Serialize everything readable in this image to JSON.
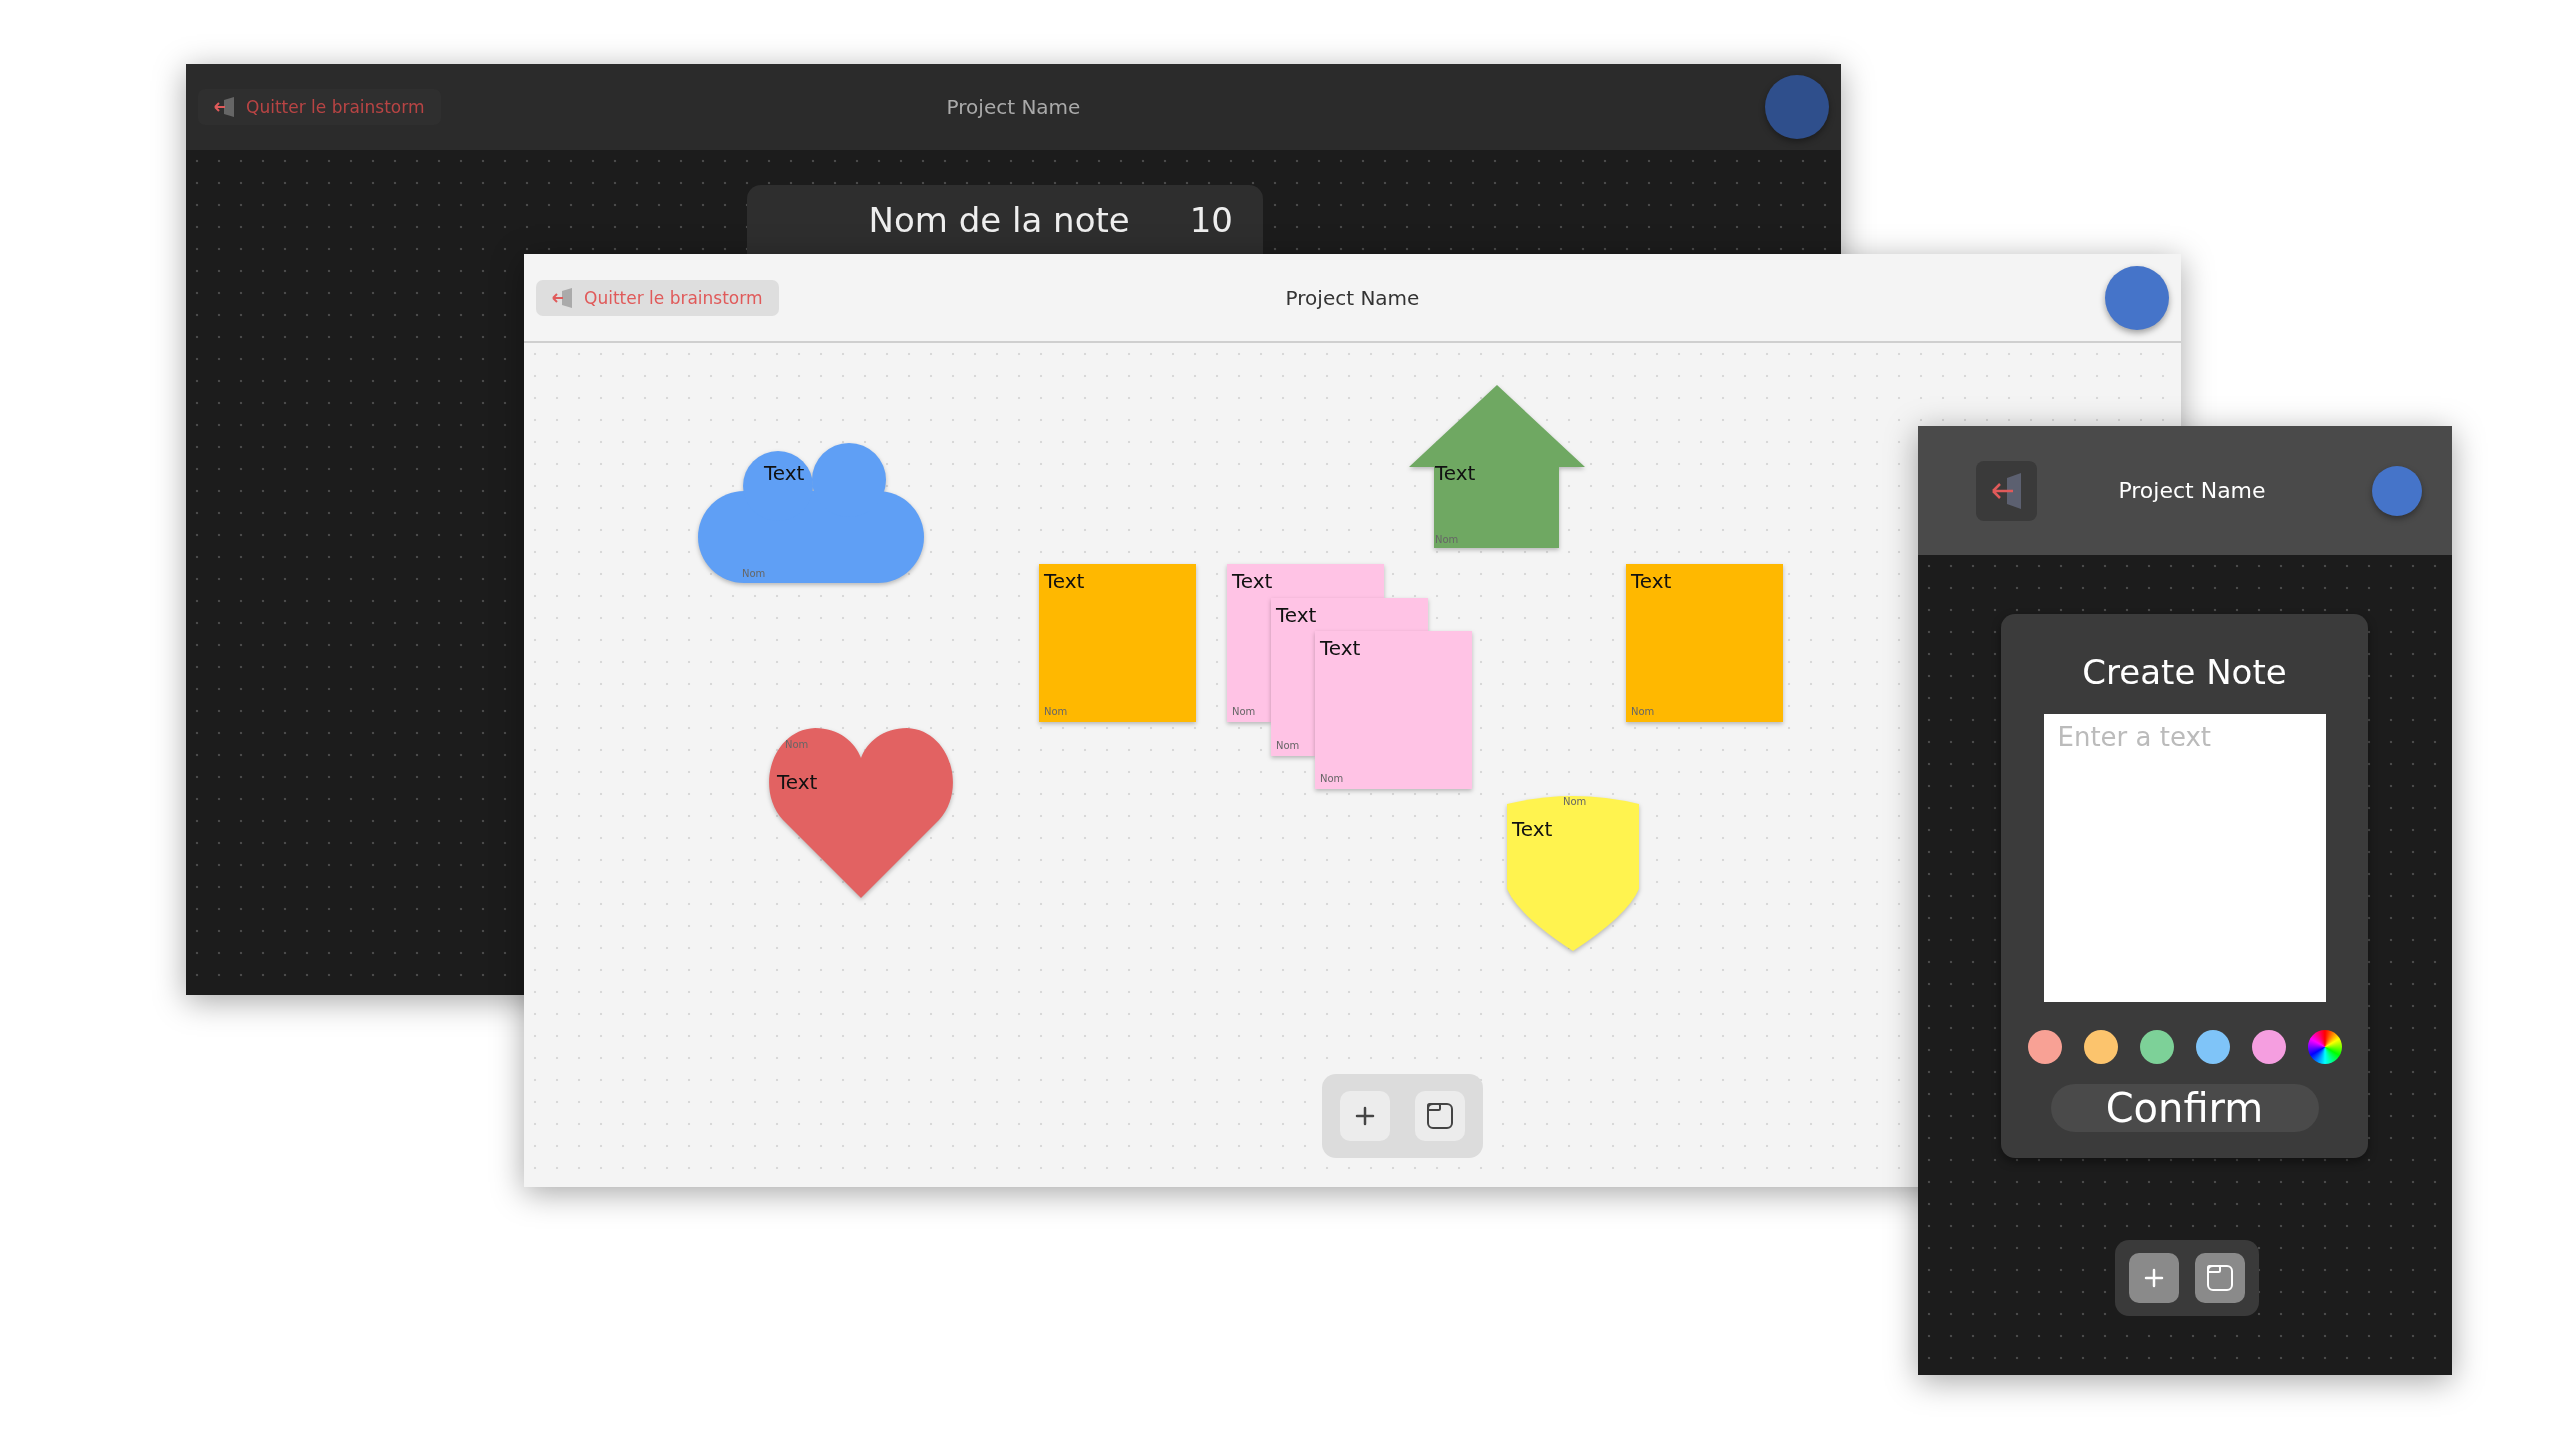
{
  "back_window": {
    "header": {
      "quit_button": "Quitter le brainstorm",
      "title": "Project Name"
    },
    "note_header": {
      "name": "Nom de la note",
      "count": "10"
    }
  },
  "main_window": {
    "header": {
      "quit_button": "Quitter le brainstorm",
      "title": "Project Name"
    },
    "notes": [
      {
        "kind": "cloud",
        "color": "#5f9ff5",
        "text": "Text",
        "author": "Nom"
      },
      {
        "kind": "heart",
        "color": "#e26262",
        "text": "Text",
        "author": "Nom"
      },
      {
        "kind": "square",
        "color": "#ffb800",
        "text": "Text",
        "author": "Nom"
      },
      {
        "kind": "square",
        "color": "#ffc3e5",
        "text": "Text",
        "author": "Nom"
      },
      {
        "kind": "square",
        "color": "#ffc3e5",
        "text": "Text",
        "author": "Nom"
      },
      {
        "kind": "square",
        "color": "#ffc3e5",
        "text": "Text",
        "author": "Nom"
      },
      {
        "kind": "arrow",
        "color": "#6fa862",
        "text": "Text",
        "author": "Nom"
      },
      {
        "kind": "square",
        "color": "#ffb800",
        "text": "Text",
        "author": "Nom"
      },
      {
        "kind": "shield",
        "color": "#fff34f",
        "text": "Text",
        "author": "Nom"
      }
    ]
  },
  "mobile_window": {
    "header": {
      "title": "Project Name"
    },
    "dialog": {
      "title": "Create Note",
      "placeholder": "Enter a text",
      "swatches": [
        {
          "kind": "solid",
          "color": "#f8a195"
        },
        {
          "kind": "solid",
          "color": "#fcc46d"
        },
        {
          "kind": "solid",
          "color": "#7dd198"
        },
        {
          "kind": "solid",
          "color": "#7fc4f8"
        },
        {
          "kind": "solid",
          "color": "#f59ee0"
        },
        {
          "kind": "picker"
        }
      ],
      "confirm_button": "Confirm"
    }
  }
}
